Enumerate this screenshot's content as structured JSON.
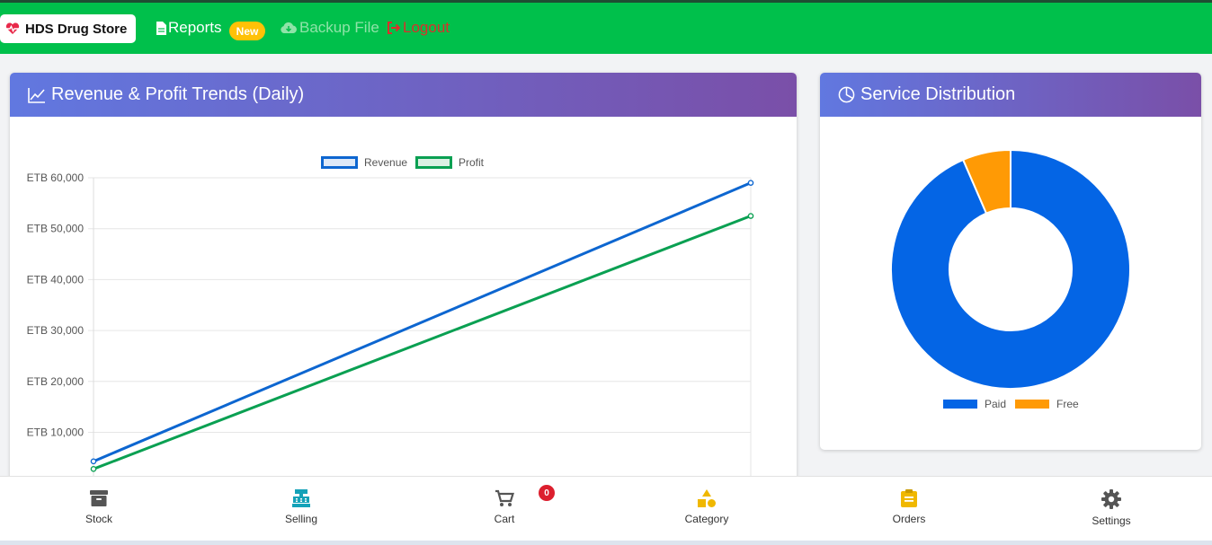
{
  "nav": {
    "brand": "HDS Drug Store",
    "reports_label": "Reports",
    "new_badge": "New",
    "backup_label": "Backup File",
    "logout_label": "Logout"
  },
  "revenue_card": {
    "title": "Revenue & Profit Trends (Daily)"
  },
  "service_card": {
    "title": "Service Distribution"
  },
  "chart_data": [
    {
      "type": "line",
      "title": "",
      "xlabel": "",
      "ylabel": "",
      "y_ticks": [
        "ETB 60,000",
        "ETB 50,000",
        "ETB 40,000",
        "ETB 30,000",
        "ETB 20,000",
        "ETB 10,000"
      ],
      "y_tick_values": [
        60000,
        50000,
        40000,
        30000,
        20000,
        10000
      ],
      "ylim": [
        0,
        60000
      ],
      "grid": true,
      "legend": "top",
      "series": [
        {
          "name": "Revenue",
          "color": "#0d66d0",
          "x": [
            0,
            1
          ],
          "values": [
            4300,
            59000
          ]
        },
        {
          "name": "Profit",
          "color": "#0aa052",
          "x": [
            0,
            1
          ],
          "values": [
            2800,
            52500
          ]
        }
      ]
    },
    {
      "type": "pie",
      "title": "",
      "legend": "bottom",
      "slices": [
        {
          "name": "Paid",
          "color": "#0465e5",
          "value": 93.5
        },
        {
          "name": "Free",
          "color": "#ff9a05",
          "value": 6.5
        }
      ]
    }
  ],
  "bottom_nav": {
    "items": [
      {
        "label": "Stock",
        "icon": "archive-icon",
        "color": "#555555"
      },
      {
        "label": "Selling",
        "icon": "cash-register-icon",
        "color": "#14a2b8"
      },
      {
        "label": "Cart",
        "icon": "cart-icon",
        "color": "#555555"
      },
      {
        "label": "Category",
        "icon": "shapes-icon",
        "color": "#f0b800"
      },
      {
        "label": "Orders",
        "icon": "clipboard-icon",
        "color": "#f0b800"
      },
      {
        "label": "Settings",
        "icon": "gear-icon",
        "color": "#555555"
      }
    ],
    "cart_count": "0"
  }
}
